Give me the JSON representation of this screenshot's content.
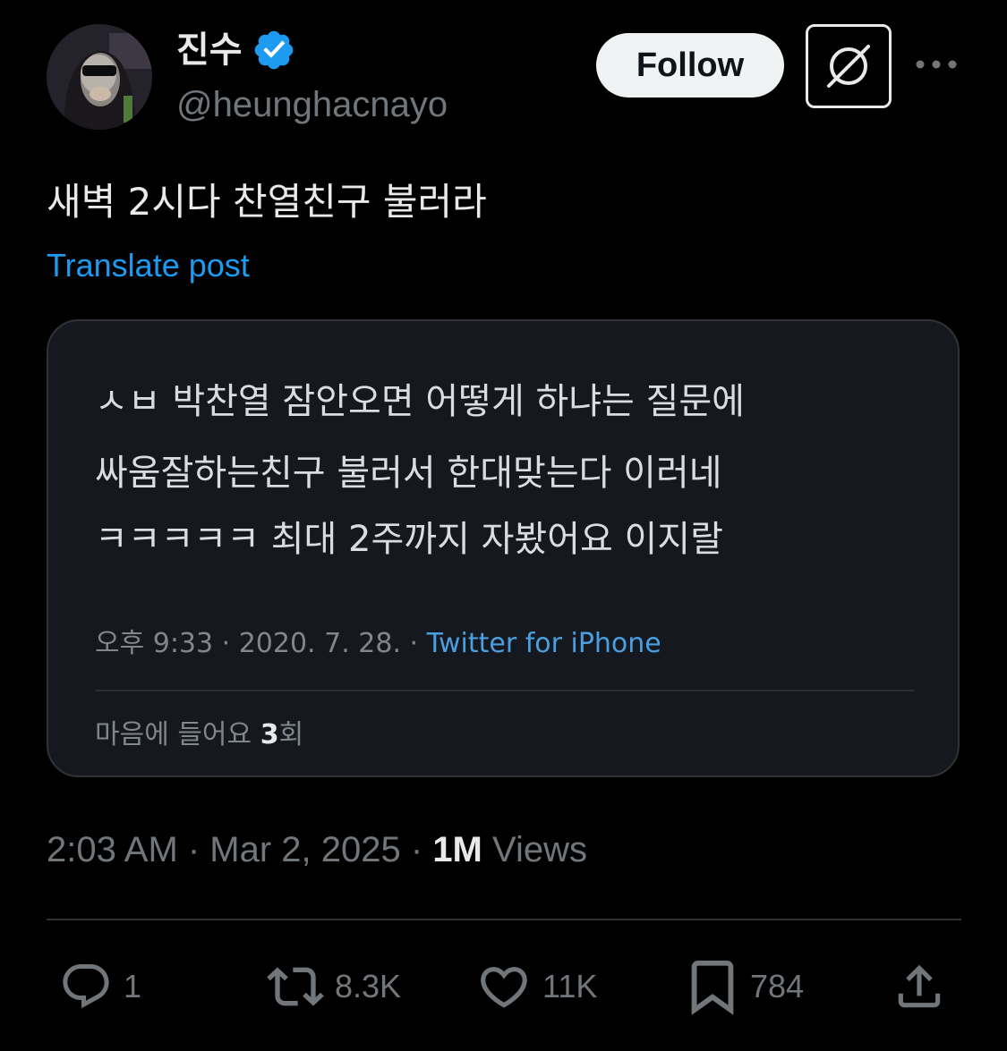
{
  "author": {
    "display_name": "진수",
    "handle": "@heunghacnayo",
    "verified_icon": "verified-badge-icon",
    "avatar_icon": "avatar"
  },
  "header": {
    "follow_label": "Follow",
    "grok_icon": "grok-icon",
    "more_icon": "more-icon"
  },
  "post": {
    "text": "새벽 2시다 찬열친구 불러라",
    "translate_label": "Translate post"
  },
  "embedded_image": {
    "lines": [
      "ㅅㅂ 박찬열 잠안오면 어떻게 하냐는 질문에",
      "싸움잘하는친구 불러서 한대맞는다 이러네",
      "ㅋㅋㅋㅋㅋ 최대 2주까지 자봤어요 이지랄"
    ],
    "meta_time": "오후 9:33 · 2020. 7. 28. · ",
    "meta_source": "Twitter for iPhone",
    "likes_prefix": "마음에 들어요 ",
    "likes_count": "3",
    "likes_suffix": "회"
  },
  "meta": {
    "timestamp": "2:03 AM · Mar 2, 2025 · ",
    "views_count": "1M",
    "views_label": " Views"
  },
  "actions": {
    "reply_count": "1",
    "repost_count": "8.3K",
    "like_count": "11K",
    "bookmark_count": "784"
  },
  "colors": {
    "background": "#000000",
    "text_primary": "#e7e9ea",
    "text_secondary": "#71767b",
    "link_blue": "#1d9bf0",
    "border": "#2f3336"
  }
}
